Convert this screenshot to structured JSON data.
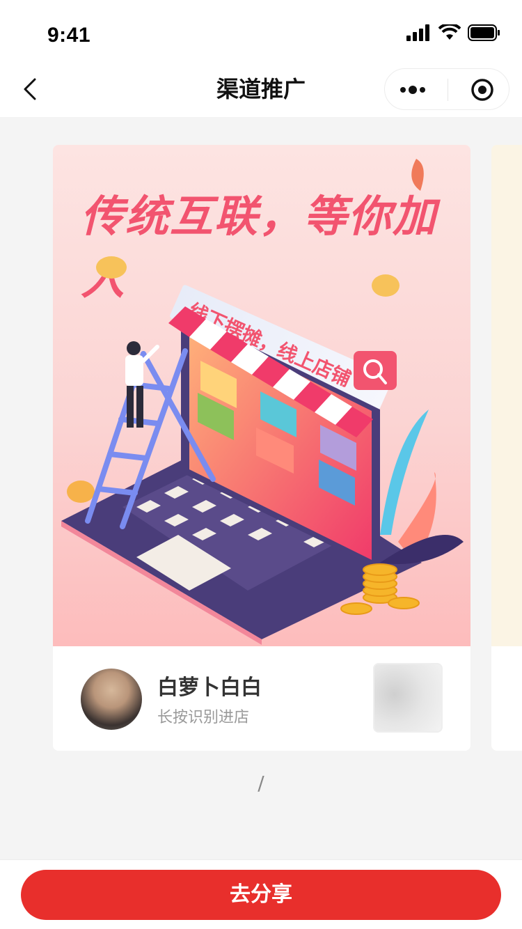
{
  "status_bar": {
    "time": "9:41"
  },
  "nav": {
    "title": "渠道推广"
  },
  "poster": {
    "headline": "传统互联，等你加入",
    "banner_text": "线下摆摊，线上店铺",
    "user_name": "白萝卜白白",
    "hint": "长按识别进店"
  },
  "pager": {
    "text": "/"
  },
  "actions": {
    "share_label": "去分享"
  },
  "colors": {
    "primary": "#e82f2c",
    "headline": "#f2546f"
  }
}
